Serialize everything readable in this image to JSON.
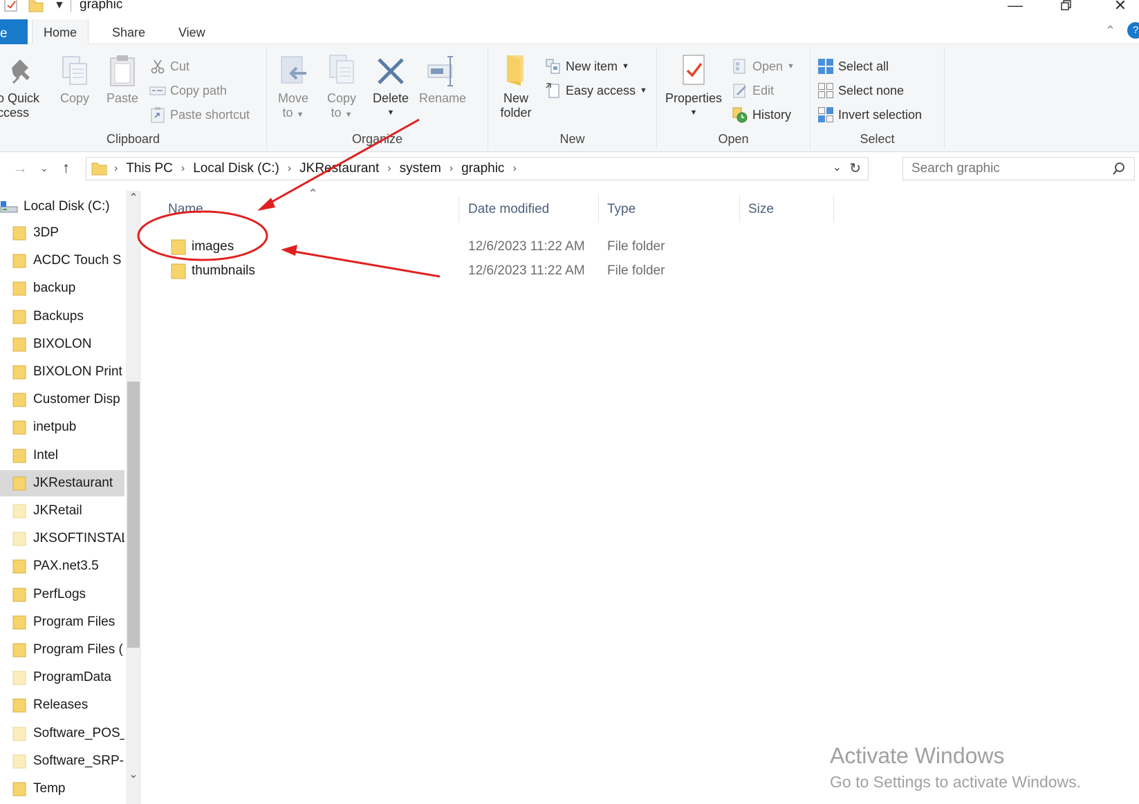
{
  "window": {
    "title": "graphic"
  },
  "tabs": {
    "file": "e",
    "home": "Home",
    "share": "Share",
    "view": "View"
  },
  "ribbon": {
    "clipboard": {
      "group_label": "Clipboard",
      "pin_line1": "o Quick",
      "pin_line2": "ccess",
      "copy": "Copy",
      "paste": "Paste",
      "cut": "Cut",
      "copy_path": "Copy path",
      "paste_shortcut": "Paste shortcut"
    },
    "organize": {
      "group_label": "Organize",
      "move_line1": "Move",
      "move_line2": "to",
      "copy_line1": "Copy",
      "copy_line2": "to",
      "delete": "Delete",
      "rename": "Rename"
    },
    "new": {
      "group_label": "New",
      "new_folder_line1": "New",
      "new_folder_line2": "folder",
      "new_item": "New item",
      "easy_access": "Easy access"
    },
    "open": {
      "group_label": "Open",
      "properties": "Properties",
      "open": "Open",
      "edit": "Edit",
      "history": "History"
    },
    "select": {
      "group_label": "Select",
      "select_all": "Select all",
      "select_none": "Select none",
      "invert_selection": "Invert selection"
    }
  },
  "address": {
    "crumbs": [
      "This PC",
      "Local Disk (C:)",
      "JKRestaurant",
      "system",
      "graphic"
    ],
    "search_placeholder": "Search graphic"
  },
  "nav": {
    "root": "Local Disk (C:)",
    "items": [
      "3DP",
      "ACDC Touch S",
      "backup",
      "Backups",
      "BIXOLON",
      "BIXOLON Print",
      "Customer Disp",
      "inetpub",
      "Intel",
      "JKRestaurant",
      "JKRetail",
      "JKSOFTINSTAL",
      "PAX.net3.5",
      "PerfLogs",
      "Program Files",
      "Program Files (",
      "ProgramData",
      "Releases",
      "Software_POS_",
      "Software_SRP-",
      "Temp"
    ],
    "selected": "JKRestaurant"
  },
  "filelist": {
    "columns": {
      "name": "Name",
      "date": "Date modified",
      "type": "Type",
      "size": "Size"
    },
    "rows": [
      {
        "name": "images",
        "date": "12/6/2023 11:22 AM",
        "type": "File folder",
        "size": ""
      },
      {
        "name": "thumbnails",
        "date": "12/6/2023 11:22 AM",
        "type": "File folder",
        "size": ""
      }
    ]
  },
  "watermark": {
    "line1": "Activate Windows",
    "line2": "Go to Settings to activate Windows."
  },
  "colors": {
    "accent": "#1979ca",
    "annotation": "#e02020",
    "folder": "#f7d36b"
  }
}
